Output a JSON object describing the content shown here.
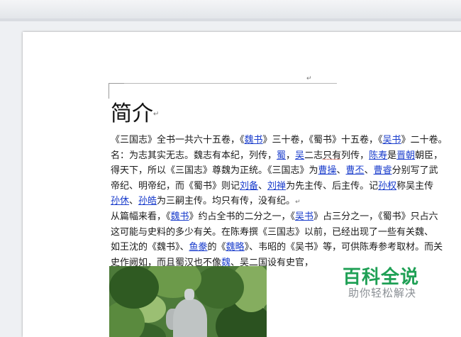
{
  "document": {
    "heading": "简介",
    "lines": [
      [
        {
          "t": "《三国志》全书一共六十五卷，《"
        },
        {
          "t": "魏书",
          "link": true
        },
        {
          "t": "》三十卷，《蜀书》十五卷，《"
        },
        {
          "t": "吴书",
          "link": true
        },
        {
          "t": "》二十卷。"
        }
      ],
      [
        {
          "t": "名：为志其实无志。魏志有本纪，列传，"
        },
        {
          "t": "蜀",
          "link": true
        },
        {
          "t": "，"
        },
        {
          "t": "吴",
          "link": true
        },
        {
          "t": "二志"
        },
        {
          "t": "只有",
          "dotted": true
        },
        {
          "t": "列传，"
        },
        {
          "t": "陈寿",
          "link": true
        },
        {
          "t": "是"
        },
        {
          "t": "晋朝",
          "link": true
        },
        {
          "t": "朝臣，"
        }
      ],
      [
        {
          "t": "得天下，所以《三国志》尊魏为正统。《三国志》为"
        },
        {
          "t": "曹操",
          "link": true
        },
        {
          "t": "、"
        },
        {
          "t": "曹丕",
          "link": true
        },
        {
          "t": "、"
        },
        {
          "t": "曹睿",
          "link": true
        },
        {
          "t": "分别写了武"
        }
      ],
      [
        {
          "t": "帝纪、明帝纪，而《蜀书》则记"
        },
        {
          "t": "刘备",
          "link": true
        },
        {
          "t": "、"
        },
        {
          "t": "刘禅",
          "link": true
        },
        {
          "t": "为先主传、后主传。记"
        },
        {
          "t": "孙权",
          "link": true
        },
        {
          "t": "称吴主传"
        }
      ],
      [
        {
          "t": "孙休",
          "link": true
        },
        {
          "t": "、"
        },
        {
          "t": "孙皓",
          "link": true
        },
        {
          "t": "为三嗣主传。均只有传，没有纪。"
        },
        {
          "t": "↵",
          "pm": true
        }
      ],
      [
        {
          "t": "从篇幅来看，《"
        },
        {
          "t": "魏书",
          "link": true
        },
        {
          "t": "》约占全书的二分之一，《"
        },
        {
          "t": "吴书",
          "link": true
        },
        {
          "t": "》占三分之一，《蜀书》只占六"
        }
      ],
      [
        {
          "t": "这可能与史料的多少有关。在陈寿撰《三国志》以前，已经出现了一些有关魏、"
        }
      ],
      [
        {
          "t": "如王沈的《魏书》、"
        },
        {
          "t": "鱼豢",
          "link": true
        },
        {
          "t": "的《"
        },
        {
          "t": "魏略",
          "link": true
        },
        {
          "t": "》、韦昭的《吴书》等，可供陈寿参考取材。而关"
        }
      ],
      [
        {
          "t": "史作阙如，而且蜀汉也不像"
        },
        {
          "t": "魏",
          "link": true
        },
        {
          "t": "、吴二国设有史官，"
        }
      ]
    ],
    "paragraph_mark": "↵"
  },
  "watermark": {
    "title": "百科全说",
    "subtitle": "助你轻松解决"
  }
}
